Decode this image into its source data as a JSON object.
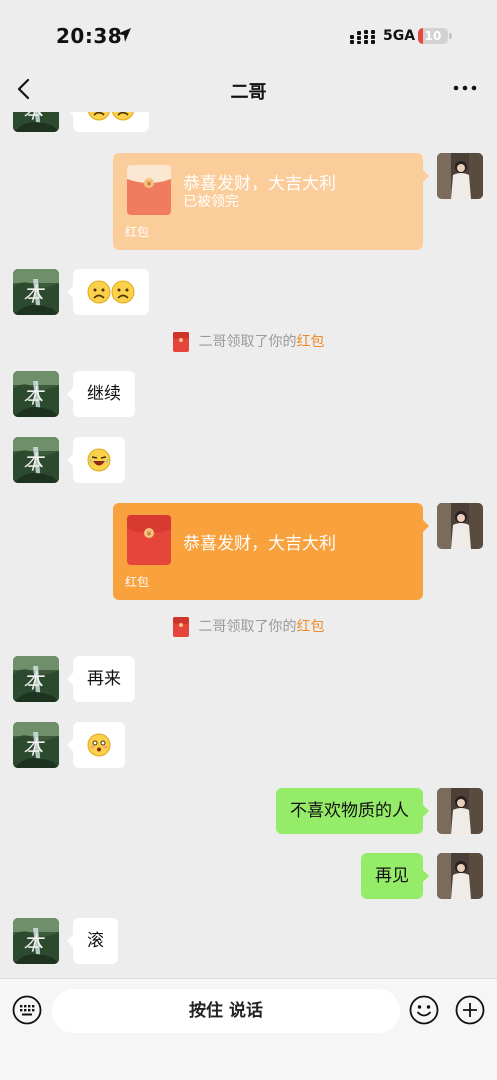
{
  "status_bar": {
    "time": "20:38",
    "network": "5GA",
    "battery": "10"
  },
  "header": {
    "title": "二哥"
  },
  "messages": {
    "rp1": {
      "title": "恭喜发财，大吉大利",
      "status": "已被领完",
      "label": "红包"
    },
    "sys1": {
      "prefix": "二哥领取了你的",
      "link": "红包"
    },
    "m_continue": "继续",
    "rp2": {
      "title": "恭喜发财，大吉大利",
      "label": "红包"
    },
    "sys2": {
      "prefix": "二哥领取了你的",
      "link": "红包"
    },
    "m_again": "再来",
    "m_out1": "不喜欢物质的人",
    "m_out2": "再见",
    "m_last": "滚"
  },
  "input_bar": {
    "hold_to_talk": "按住 说话"
  },
  "watermark": "",
  "colors": {
    "background": "#ededed",
    "outgoing_bubble": "#95ec69",
    "incoming_bubble": "#ffffff",
    "red_packet_opened": "#fbcd9b",
    "red_packet_unopened": "#f9a13c",
    "link": "#ec8a2c"
  },
  "icons": [
    "location-arrow-icon",
    "signal-icon",
    "back-chevron-icon",
    "more-dots-icon",
    "keyboard-icon",
    "emoji-smile-icon",
    "plus-circle-icon",
    "red-packet-icon"
  ]
}
